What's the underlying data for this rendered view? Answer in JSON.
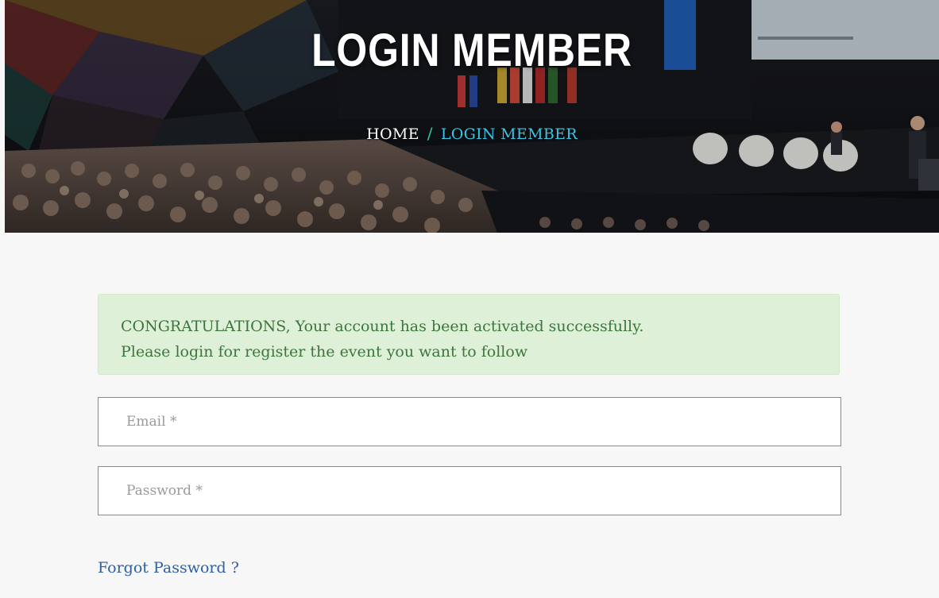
{
  "hero": {
    "title": "LOGIN MEMBER"
  },
  "breadcrumb": {
    "home": "HOME",
    "separator": "/",
    "current": "LOGIN MEMBER"
  },
  "alert": {
    "line1": "CONGRATULATIONS, Your account has been activated successfully.",
    "line2": "Please login for register the event you want to follow"
  },
  "form": {
    "email_placeholder": "Email *",
    "email_value": "",
    "password_placeholder": "Password *",
    "password_value": ""
  },
  "links": {
    "forgot_password": "Forgot Password ?"
  },
  "colors": {
    "alert_bg": "#dff0d8",
    "alert_text": "#3c763d",
    "breadcrumb_current": "#38c6e8",
    "link": "#2f5f9e"
  }
}
